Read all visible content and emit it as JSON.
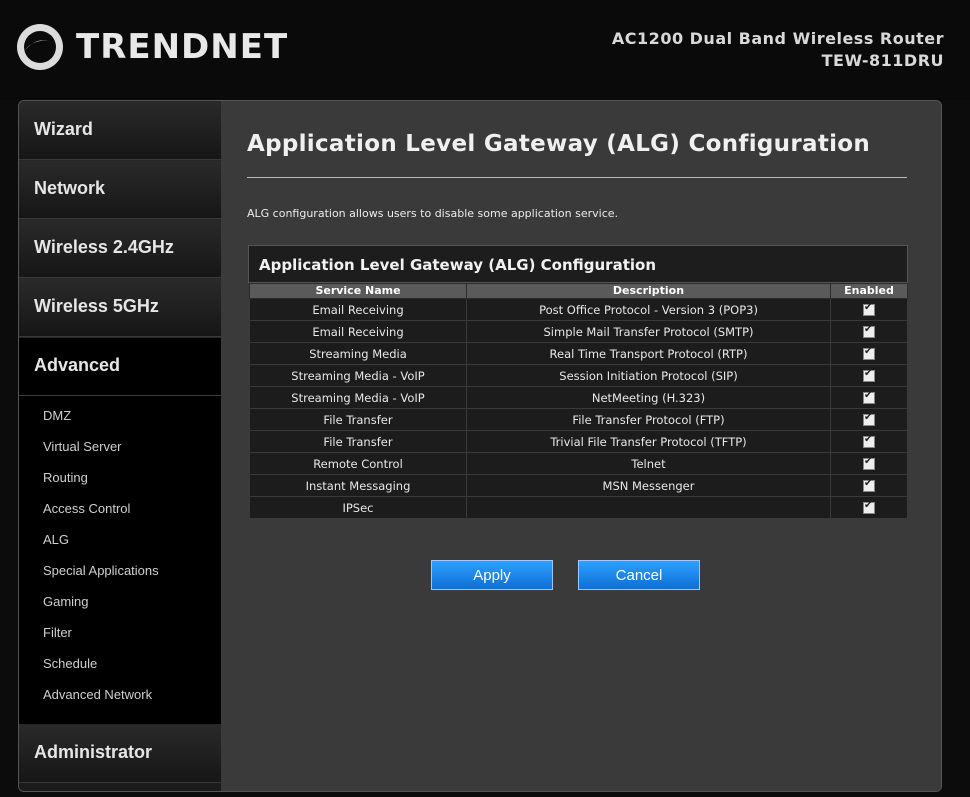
{
  "brand": {
    "name": "TRENDNET"
  },
  "model": {
    "line1": "AC1200 Dual Band Wireless Router",
    "line2": "TEW-811DRU"
  },
  "sidebar": {
    "top": [
      "Wizard",
      "Network",
      "Wireless 2.4GHz",
      "Wireless 5GHz"
    ],
    "active": "Advanced",
    "submenu": [
      "DMZ",
      "Virtual Server",
      "Routing",
      "Access Control",
      "ALG",
      "Special Applications",
      "Gaming",
      "Filter",
      "Schedule",
      "Advanced Network"
    ],
    "bottom": "Administrator"
  },
  "page": {
    "title": "Application Level Gateway (ALG) Configuration",
    "intro": "ALG configuration allows users to disable some application service.",
    "panel_title": "Application Level Gateway (ALG) Configuration"
  },
  "table": {
    "headers": [
      "Service Name",
      "Description",
      "Enabled"
    ],
    "rows": [
      {
        "service": "Email Receiving",
        "description": "Post Office Protocol - Version 3 (POP3)",
        "enabled": true
      },
      {
        "service": "Email Receiving",
        "description": "Simple Mail Transfer Protocol (SMTP)",
        "enabled": true
      },
      {
        "service": "Streaming Media",
        "description": "Real Time Transport Protocol (RTP)",
        "enabled": true
      },
      {
        "service": "Streaming Media - VoIP",
        "description": "Session Initiation Protocol (SIP)",
        "enabled": true
      },
      {
        "service": "Streaming Media - VoIP",
        "description": "NetMeeting (H.323)",
        "enabled": true
      },
      {
        "service": "File Transfer",
        "description": "File Transfer Protocol (FTP)",
        "enabled": true
      },
      {
        "service": "File Transfer",
        "description": "Trivial File Transfer Protocol (TFTP)",
        "enabled": true
      },
      {
        "service": "Remote Control",
        "description": "Telnet",
        "enabled": true
      },
      {
        "service": "Instant Messaging",
        "description": "MSN Messenger",
        "enabled": true
      },
      {
        "service": "IPSec",
        "description": "",
        "enabled": true
      }
    ]
  },
  "buttons": {
    "apply": "Apply",
    "cancel": "Cancel"
  }
}
